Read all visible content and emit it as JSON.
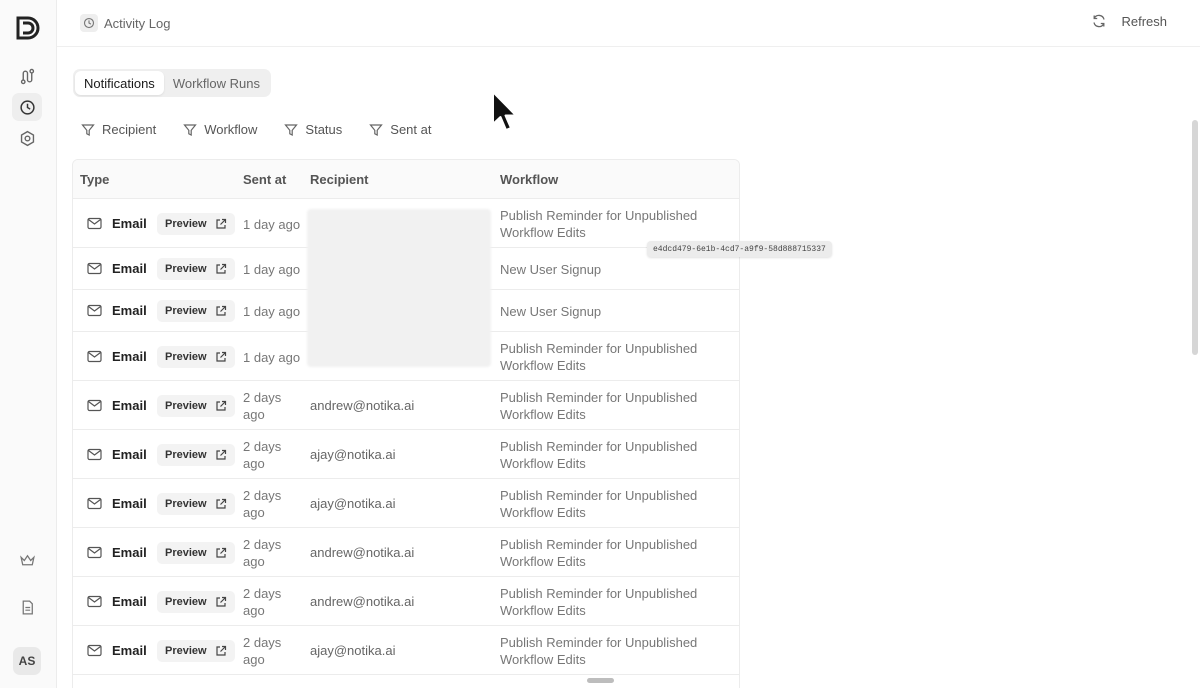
{
  "sidebar": {
    "logo": "logo-d",
    "items": [
      {
        "icon": "workflow-icon",
        "active": false
      },
      {
        "icon": "history-icon",
        "active": true
      },
      {
        "icon": "settings-icon",
        "active": false
      }
    ],
    "bottom_items": [
      {
        "icon": "crown-icon"
      },
      {
        "icon": "document-icon"
      }
    ],
    "avatar": "AS"
  },
  "header": {
    "breadcrumb": "Activity Log",
    "refresh_label": "Refresh"
  },
  "tabs": [
    {
      "label": "Notifications",
      "active": true
    },
    {
      "label": "Workflow Runs",
      "active": false
    }
  ],
  "filters": [
    {
      "label": "Recipient"
    },
    {
      "label": "Workflow"
    },
    {
      "label": "Status"
    },
    {
      "label": "Sent at"
    }
  ],
  "table": {
    "columns": [
      "Type",
      "Sent at",
      "Recipient",
      "Workflow"
    ],
    "preview_label": "Preview",
    "rows": [
      {
        "type": "Email",
        "sent_at": "1 day ago",
        "recipient": "",
        "workflow": "Publish Reminder for Unpublished Workflow Edits"
      },
      {
        "type": "Email",
        "sent_at": "1 day ago",
        "recipient": "",
        "workflow": "New User Signup"
      },
      {
        "type": "Email",
        "sent_at": "1 day ago",
        "recipient": "",
        "workflow": "New User Signup"
      },
      {
        "type": "Email",
        "sent_at": "1 day ago",
        "recipient": "",
        "workflow": "Publish Reminder for Unpublished Workflow Edits"
      },
      {
        "type": "Email",
        "sent_at": "2 days ago",
        "recipient": "andrew@notika.ai",
        "workflow": "Publish Reminder for Unpublished Workflow Edits"
      },
      {
        "type": "Email",
        "sent_at": "2 days ago",
        "recipient": "ajay@notika.ai",
        "workflow": "Publish Reminder for Unpublished Workflow Edits"
      },
      {
        "type": "Email",
        "sent_at": "2 days ago",
        "recipient": "ajay@notika.ai",
        "workflow": "Publish Reminder for Unpublished Workflow Edits"
      },
      {
        "type": "Email",
        "sent_at": "2 days ago",
        "recipient": "andrew@notika.ai",
        "workflow": "Publish Reminder for Unpublished Workflow Edits"
      },
      {
        "type": "Email",
        "sent_at": "2 days ago",
        "recipient": "andrew@notika.ai",
        "workflow": "Publish Reminder for Unpublished Workflow Edits"
      },
      {
        "type": "Email",
        "sent_at": "2 days ago",
        "recipient": "ajay@notika.ai",
        "workflow": "Publish Reminder for Unpublished Workflow Edits"
      }
    ]
  },
  "tooltip": "e4dcd479-6e1b-4cd7-a9f9-58d888715337"
}
